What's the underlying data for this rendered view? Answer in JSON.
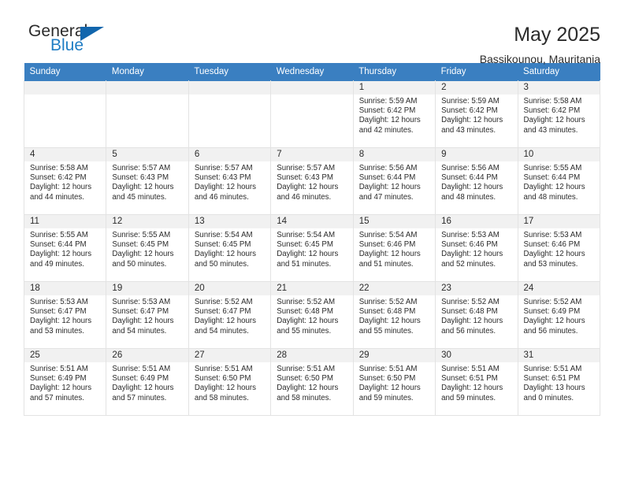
{
  "brand": {
    "name_top": "General",
    "name_bottom": "Blue",
    "accent_color": "#1266ad",
    "blue_text_color": "#1f7dc4"
  },
  "header": {
    "title": "May 2025",
    "subtitle": "Bassikounou, Mauritania"
  },
  "calendar": {
    "header_bg": "#3a7fc1",
    "daynum_bg": "#f1f1f1",
    "weekday_headers": [
      "Sunday",
      "Monday",
      "Tuesday",
      "Wednesday",
      "Thursday",
      "Friday",
      "Saturday"
    ],
    "weeks": [
      [
        {
          "day": "",
          "sunrise": "",
          "sunset": "",
          "daylight_line1": "",
          "daylight_line2": ""
        },
        {
          "day": "",
          "sunrise": "",
          "sunset": "",
          "daylight_line1": "",
          "daylight_line2": ""
        },
        {
          "day": "",
          "sunrise": "",
          "sunset": "",
          "daylight_line1": "",
          "daylight_line2": ""
        },
        {
          "day": "",
          "sunrise": "",
          "sunset": "",
          "daylight_line1": "",
          "daylight_line2": ""
        },
        {
          "day": "1",
          "sunrise": "Sunrise: 5:59 AM",
          "sunset": "Sunset: 6:42 PM",
          "daylight_line1": "Daylight: 12 hours",
          "daylight_line2": "and 42 minutes."
        },
        {
          "day": "2",
          "sunrise": "Sunrise: 5:59 AM",
          "sunset": "Sunset: 6:42 PM",
          "daylight_line1": "Daylight: 12 hours",
          "daylight_line2": "and 43 minutes."
        },
        {
          "day": "3",
          "sunrise": "Sunrise: 5:58 AM",
          "sunset": "Sunset: 6:42 PM",
          "daylight_line1": "Daylight: 12 hours",
          "daylight_line2": "and 43 minutes."
        }
      ],
      [
        {
          "day": "4",
          "sunrise": "Sunrise: 5:58 AM",
          "sunset": "Sunset: 6:42 PM",
          "daylight_line1": "Daylight: 12 hours",
          "daylight_line2": "and 44 minutes."
        },
        {
          "day": "5",
          "sunrise": "Sunrise: 5:57 AM",
          "sunset": "Sunset: 6:43 PM",
          "daylight_line1": "Daylight: 12 hours",
          "daylight_line2": "and 45 minutes."
        },
        {
          "day": "6",
          "sunrise": "Sunrise: 5:57 AM",
          "sunset": "Sunset: 6:43 PM",
          "daylight_line1": "Daylight: 12 hours",
          "daylight_line2": "and 46 minutes."
        },
        {
          "day": "7",
          "sunrise": "Sunrise: 5:57 AM",
          "sunset": "Sunset: 6:43 PM",
          "daylight_line1": "Daylight: 12 hours",
          "daylight_line2": "and 46 minutes."
        },
        {
          "day": "8",
          "sunrise": "Sunrise: 5:56 AM",
          "sunset": "Sunset: 6:44 PM",
          "daylight_line1": "Daylight: 12 hours",
          "daylight_line2": "and 47 minutes."
        },
        {
          "day": "9",
          "sunrise": "Sunrise: 5:56 AM",
          "sunset": "Sunset: 6:44 PM",
          "daylight_line1": "Daylight: 12 hours",
          "daylight_line2": "and 48 minutes."
        },
        {
          "day": "10",
          "sunrise": "Sunrise: 5:55 AM",
          "sunset": "Sunset: 6:44 PM",
          "daylight_line1": "Daylight: 12 hours",
          "daylight_line2": "and 48 minutes."
        }
      ],
      [
        {
          "day": "11",
          "sunrise": "Sunrise: 5:55 AM",
          "sunset": "Sunset: 6:44 PM",
          "daylight_line1": "Daylight: 12 hours",
          "daylight_line2": "and 49 minutes."
        },
        {
          "day": "12",
          "sunrise": "Sunrise: 5:55 AM",
          "sunset": "Sunset: 6:45 PM",
          "daylight_line1": "Daylight: 12 hours",
          "daylight_line2": "and 50 minutes."
        },
        {
          "day": "13",
          "sunrise": "Sunrise: 5:54 AM",
          "sunset": "Sunset: 6:45 PM",
          "daylight_line1": "Daylight: 12 hours",
          "daylight_line2": "and 50 minutes."
        },
        {
          "day": "14",
          "sunrise": "Sunrise: 5:54 AM",
          "sunset": "Sunset: 6:45 PM",
          "daylight_line1": "Daylight: 12 hours",
          "daylight_line2": "and 51 minutes."
        },
        {
          "day": "15",
          "sunrise": "Sunrise: 5:54 AM",
          "sunset": "Sunset: 6:46 PM",
          "daylight_line1": "Daylight: 12 hours",
          "daylight_line2": "and 51 minutes."
        },
        {
          "day": "16",
          "sunrise": "Sunrise: 5:53 AM",
          "sunset": "Sunset: 6:46 PM",
          "daylight_line1": "Daylight: 12 hours",
          "daylight_line2": "and 52 minutes."
        },
        {
          "day": "17",
          "sunrise": "Sunrise: 5:53 AM",
          "sunset": "Sunset: 6:46 PM",
          "daylight_line1": "Daylight: 12 hours",
          "daylight_line2": "and 53 minutes."
        }
      ],
      [
        {
          "day": "18",
          "sunrise": "Sunrise: 5:53 AM",
          "sunset": "Sunset: 6:47 PM",
          "daylight_line1": "Daylight: 12 hours",
          "daylight_line2": "and 53 minutes."
        },
        {
          "day": "19",
          "sunrise": "Sunrise: 5:53 AM",
          "sunset": "Sunset: 6:47 PM",
          "daylight_line1": "Daylight: 12 hours",
          "daylight_line2": "and 54 minutes."
        },
        {
          "day": "20",
          "sunrise": "Sunrise: 5:52 AM",
          "sunset": "Sunset: 6:47 PM",
          "daylight_line1": "Daylight: 12 hours",
          "daylight_line2": "and 54 minutes."
        },
        {
          "day": "21",
          "sunrise": "Sunrise: 5:52 AM",
          "sunset": "Sunset: 6:48 PM",
          "daylight_line1": "Daylight: 12 hours",
          "daylight_line2": "and 55 minutes."
        },
        {
          "day": "22",
          "sunrise": "Sunrise: 5:52 AM",
          "sunset": "Sunset: 6:48 PM",
          "daylight_line1": "Daylight: 12 hours",
          "daylight_line2": "and 55 minutes."
        },
        {
          "day": "23",
          "sunrise": "Sunrise: 5:52 AM",
          "sunset": "Sunset: 6:48 PM",
          "daylight_line1": "Daylight: 12 hours",
          "daylight_line2": "and 56 minutes."
        },
        {
          "day": "24",
          "sunrise": "Sunrise: 5:52 AM",
          "sunset": "Sunset: 6:49 PM",
          "daylight_line1": "Daylight: 12 hours",
          "daylight_line2": "and 56 minutes."
        }
      ],
      [
        {
          "day": "25",
          "sunrise": "Sunrise: 5:51 AM",
          "sunset": "Sunset: 6:49 PM",
          "daylight_line1": "Daylight: 12 hours",
          "daylight_line2": "and 57 minutes."
        },
        {
          "day": "26",
          "sunrise": "Sunrise: 5:51 AM",
          "sunset": "Sunset: 6:49 PM",
          "daylight_line1": "Daylight: 12 hours",
          "daylight_line2": "and 57 minutes."
        },
        {
          "day": "27",
          "sunrise": "Sunrise: 5:51 AM",
          "sunset": "Sunset: 6:50 PM",
          "daylight_line1": "Daylight: 12 hours",
          "daylight_line2": "and 58 minutes."
        },
        {
          "day": "28",
          "sunrise": "Sunrise: 5:51 AM",
          "sunset": "Sunset: 6:50 PM",
          "daylight_line1": "Daylight: 12 hours",
          "daylight_line2": "and 58 minutes."
        },
        {
          "day": "29",
          "sunrise": "Sunrise: 5:51 AM",
          "sunset": "Sunset: 6:50 PM",
          "daylight_line1": "Daylight: 12 hours",
          "daylight_line2": "and 59 minutes."
        },
        {
          "day": "30",
          "sunrise": "Sunrise: 5:51 AM",
          "sunset": "Sunset: 6:51 PM",
          "daylight_line1": "Daylight: 12 hours",
          "daylight_line2": "and 59 minutes."
        },
        {
          "day": "31",
          "sunrise": "Sunrise: 5:51 AM",
          "sunset": "Sunset: 6:51 PM",
          "daylight_line1": "Daylight: 13 hours",
          "daylight_line2": "and 0 minutes."
        }
      ]
    ]
  }
}
